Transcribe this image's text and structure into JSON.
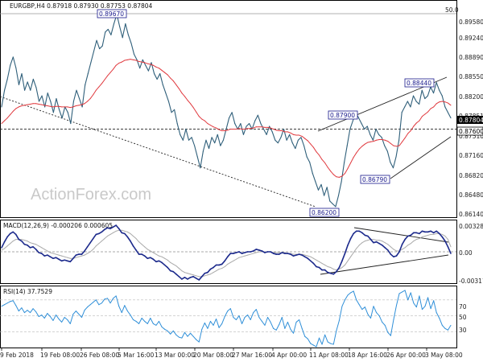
{
  "chart_data": [
    {
      "type": "line",
      "title": "EURGBP,H4  0.87918 0.87930 0.87753 0.87804",
      "watermark": "ActionForex.com",
      "y_ticks": [
        "0.89580",
        "0.89240",
        "0.88890",
        "0.88550",
        "0.88200",
        "0.87851",
        "0.87510",
        "0.87160",
        "0.86820",
        "0.86480",
        "0.86140"
      ],
      "ylim": [
        0.8601,
        0.899
      ],
      "x_ticks": [
        "9 Feb 2018",
        "19 Feb 08:00",
        "26 Feb 08:00",
        "5 Mar 16:00",
        "13 Mar 00:00",
        "20 Mar 08:00",
        "27 Mar 16:00",
        "4 Apr 00:00",
        "11 Apr 08:00",
        "18 Apr 16:00",
        "26 Apr 00:00",
        "3 May 08:00"
      ],
      "fib_label": "50.0",
      "current_price_label": "0.87804",
      "support_label": "0.87600",
      "support_level": 0.876,
      "annotations": [
        "0.89670",
        "0.87900",
        "0.88440",
        "0.86790",
        "0.86200"
      ],
      "price": [
        0.88,
        0.883,
        0.885,
        0.8875,
        0.889,
        0.887,
        0.884,
        0.886,
        0.883,
        0.8845,
        0.883,
        0.885,
        0.8835,
        0.881,
        0.882,
        0.88,
        0.8825,
        0.881,
        0.879,
        0.8815,
        0.8795,
        0.878,
        0.88,
        0.879,
        0.877,
        0.881,
        0.883,
        0.8815,
        0.88,
        0.884,
        0.886,
        0.888,
        0.89,
        0.892,
        0.8905,
        0.891,
        0.8935,
        0.894,
        0.893,
        0.895,
        0.8967,
        0.8945,
        0.8925,
        0.895,
        0.893,
        0.8915,
        0.8895,
        0.8885,
        0.887,
        0.8885,
        0.8875,
        0.8865,
        0.888,
        0.886,
        0.885,
        0.886,
        0.884,
        0.8825,
        0.881,
        0.879,
        0.8795,
        0.877,
        0.875,
        0.874,
        0.876,
        0.874,
        0.8745,
        0.873,
        0.871,
        0.869,
        0.872,
        0.874,
        0.8725,
        0.8745,
        0.8735,
        0.875,
        0.873,
        0.874,
        0.876,
        0.878,
        0.879,
        0.877,
        0.876,
        0.877,
        0.875,
        0.8765,
        0.877,
        0.876,
        0.8775,
        0.8785,
        0.877,
        0.876,
        0.875,
        0.8765,
        0.8755,
        0.874,
        0.8735,
        0.8745,
        0.876,
        0.874,
        0.875,
        0.8735,
        0.8725,
        0.874,
        0.8745,
        0.873,
        0.871,
        0.87,
        0.868,
        0.8665,
        0.865,
        0.866,
        0.864,
        0.8655,
        0.863,
        0.8625,
        0.862,
        0.864,
        0.8665,
        0.87,
        0.873,
        0.876,
        0.8775,
        0.879,
        0.878,
        0.877,
        0.876,
        0.8765,
        0.875,
        0.874,
        0.876,
        0.875,
        0.8745,
        0.873,
        0.872,
        0.87,
        0.869,
        0.871,
        0.874,
        0.879,
        0.88,
        0.881,
        0.88,
        0.882,
        0.881,
        0.8805,
        0.883,
        0.8815,
        0.882,
        0.8836,
        0.8825,
        0.8844,
        0.883,
        0.882,
        0.88,
        0.879,
        0.878
      ],
      "ma": [
        0.877,
        0.8775,
        0.878,
        0.8786,
        0.8792,
        0.8797,
        0.88,
        0.8802,
        0.8803,
        0.8804,
        0.8805,
        0.8806,
        0.8806,
        0.8805,
        0.8804,
        0.8803,
        0.8802,
        0.8801,
        0.88,
        0.8801,
        0.8801,
        0.88,
        0.88,
        0.88,
        0.8799,
        0.88,
        0.8802,
        0.8803,
        0.8804,
        0.8806,
        0.881,
        0.8815,
        0.8822,
        0.883,
        0.8836,
        0.8842,
        0.8849,
        0.8856,
        0.8862,
        0.8868,
        0.8875,
        0.8879,
        0.8881,
        0.8884,
        0.8885,
        0.8886,
        0.8885,
        0.8884,
        0.8882,
        0.8881,
        0.888,
        0.8878,
        0.8877,
        0.8875,
        0.8872,
        0.887,
        0.8866,
        0.8862,
        0.8858,
        0.8852,
        0.8847,
        0.884,
        0.8833,
        0.8825,
        0.8819,
        0.8812,
        0.8806,
        0.8799,
        0.8791,
        0.8783,
        0.8778,
        0.8775,
        0.877,
        0.8767,
        0.8764,
        0.8762,
        0.8759,
        0.8757,
        0.8757,
        0.8758,
        0.876,
        0.876,
        0.876,
        0.8761,
        0.876,
        0.876,
        0.8761,
        0.8761,
        0.8762,
        0.8764,
        0.8764,
        0.8764,
        0.8763,
        0.8763,
        0.8762,
        0.876,
        0.8758,
        0.8757,
        0.8757,
        0.8755,
        0.8755,
        0.8753,
        0.875,
        0.8749,
        0.8749,
        0.8747,
        0.8743,
        0.8739,
        0.8733,
        0.8727,
        0.8719,
        0.8713,
        0.8705,
        0.8699,
        0.8691,
        0.8684,
        0.8678,
        0.8674,
        0.8673,
        0.8675,
        0.868,
        0.8689,
        0.8699,
        0.8709,
        0.8717,
        0.8724,
        0.8729,
        0.8733,
        0.8736,
        0.8737,
        0.8738,
        0.874,
        0.8741,
        0.8741,
        0.874,
        0.8738,
        0.8734,
        0.873,
        0.8729,
        0.873,
        0.8737,
        0.8744,
        0.8752,
        0.8757,
        0.8765,
        0.8771,
        0.8775,
        0.8783,
        0.8787,
        0.8791,
        0.8797,
        0.88,
        0.8806,
        0.8809,
        0.881,
        0.8809,
        0.8807,
        0.8803
      ]
    },
    {
      "type": "line",
      "title": "MACD(12,26,9) -0.000206 0.000605",
      "y_ticks": [
        "0.003285",
        "0.00",
        "-0.003177"
      ],
      "ylim": [
        -0.0036,
        0.0036
      ],
      "series": [
        {
          "values": [
            0.0005,
            0.0012,
            0.0018,
            0.0022,
            0.0024,
            0.0021,
            0.0015,
            0.0013,
            0.0009,
            0.0008,
            0.0005,
            0.0006,
            0.0003,
            -0.0001,
            -0.0002,
            -0.0005,
            -0.0004,
            -0.0006,
            -0.0008,
            -0.0007,
            -0.0009,
            -0.0011,
            -0.001,
            -0.0011,
            -0.0012,
            -0.0008,
            -0.0004,
            -0.0003,
            -0.0003,
            0.0001,
            0.0006,
            0.0011,
            0.0016,
            0.0021,
            0.0022,
            0.0024,
            0.0027,
            0.0029,
            0.0028,
            0.003,
            0.0032,
            0.0028,
            0.0023,
            0.0022,
            0.0018,
            0.0013,
            0.0007,
            0.0002,
            -0.0003,
            -0.0003,
            -0.0005,
            -0.0008,
            -0.0007,
            -0.0009,
            -0.0012,
            -0.0011,
            -0.0013,
            -0.0016,
            -0.0019,
            -0.0023,
            -0.0024,
            -0.0027,
            -0.003,
            -0.0033,
            -0.0031,
            -0.0033,
            -0.0031,
            -0.003,
            -0.0032,
            -0.0034,
            -0.003,
            -0.0026,
            -0.0025,
            -0.0021,
            -0.0019,
            -0.0016,
            -0.0016,
            -0.0015,
            -0.0011,
            -0.0006,
            -0.0002,
            -0.0002,
            -0.0001,
            0.0,
            -0.0002,
            -0.0001,
            0.0,
            0.0,
            0.0001,
            0.0003,
            0.0002,
            0.0001,
            -0.0001,
            0.0,
            0.0,
            -0.0002,
            -0.0003,
            -0.0003,
            -0.0001,
            -0.0002,
            -0.0002,
            -0.0003,
            -0.0005,
            -0.0004,
            -0.0003,
            -0.0004,
            -0.0006,
            -0.0008,
            -0.0011,
            -0.0014,
            -0.0018,
            -0.0019,
            -0.0022,
            -0.0022,
            -0.0025,
            -0.0026,
            -0.0027,
            -0.0024,
            -0.0019,
            -0.0011,
            -0.0002,
            0.0008,
            0.0016,
            0.0022,
            0.0025,
            0.0025,
            0.0023,
            0.002,
            0.0019,
            0.0015,
            0.0011,
            0.0012,
            0.001,
            0.0008,
            0.0005,
            0.0002,
            -0.0003,
            -0.0006,
            -0.0005,
            0.0,
            0.0009,
            0.0015,
            0.0019,
            0.002,
            0.0023,
            0.0023,
            0.0022,
            0.0025,
            0.0024,
            0.0024,
            0.0025,
            0.0023,
            0.0025,
            0.0022,
            0.0018,
            0.0013,
            0.0006,
            -0.0002
          ]
        },
        {
          "values": [
            0.0002,
            0.0004,
            0.0007,
            0.001,
            0.0013,
            0.0015,
            0.0015,
            0.0015,
            0.0014,
            0.0013,
            0.0011,
            0.001,
            0.0009,
            0.0007,
            0.0005,
            0.0003,
            0.0001,
            -0.0001,
            -0.0002,
            -0.0003,
            -0.0004,
            -0.0005,
            -0.0006,
            -0.0007,
            -0.0008,
            -0.0008,
            -0.0007,
            -0.0006,
            -0.0005,
            -0.0004,
            -0.0002,
            0.0,
            0.0003,
            0.0007,
            0.001,
            0.0013,
            0.0016,
            0.0019,
            0.0021,
            0.0023,
            0.0025,
            0.0026,
            0.0026,
            0.0025,
            0.0024,
            0.0022,
            0.0019,
            0.0016,
            0.0012,
            0.0009,
            0.0006,
            0.0003,
            0.0001,
            -0.0001,
            -0.0003,
            -0.0005,
            -0.0006,
            -0.0008,
            -0.001,
            -0.0013,
            -0.0015,
            -0.0017,
            -0.002,
            -0.0023,
            -0.0025,
            -0.0026,
            -0.0027,
            -0.0028,
            -0.0029,
            -0.003,
            -0.003,
            -0.0029,
            -0.0028,
            -0.0027,
            -0.0025,
            -0.0023,
            -0.0021,
            -0.002,
            -0.0018,
            -0.0015,
            -0.0013,
            -0.0011,
            -0.0009,
            -0.0007,
            -0.0006,
            -0.0005,
            -0.0004,
            -0.0003,
            -0.0002,
            -0.0001,
            0.0,
            0.0,
            0.0,
            0.0,
            0.0,
            -0.0001,
            -0.0001,
            -0.0001,
            -0.0001,
            -0.0001,
            -0.0002,
            -0.0002,
            -0.0003,
            -0.0003,
            -0.0003,
            -0.0003,
            -0.0004,
            -0.0005,
            -0.0006,
            -0.0008,
            -0.001,
            -0.0012,
            -0.0014,
            -0.0016,
            -0.0018,
            -0.0019,
            -0.0021,
            -0.0022,
            -0.0021,
            -0.0019,
            -0.0016,
            -0.0011,
            -0.0006,
            -0.0001,
            0.0004,
            0.0008,
            0.0011,
            0.0013,
            0.0014,
            0.0015,
            0.0015,
            0.0014,
            0.0014,
            0.0013,
            0.0011,
            0.0009,
            0.0006,
            0.0003,
            0.0001,
            0.0001,
            0.0003,
            0.0005,
            0.0008,
            0.001,
            0.0013,
            0.0015,
            0.0016,
            0.0018,
            0.0019,
            0.002,
            0.0021,
            0.0021,
            0.0022,
            0.0022,
            0.0021,
            0.0019,
            0.0015,
            0.0006
          ]
        }
      ]
    },
    {
      "type": "line",
      "title": "RSI(14) 37.7529",
      "y_ticks": [
        "70",
        "50",
        "30"
      ],
      "ylim": [
        10,
        85
      ],
      "values": [
        62,
        64,
        66,
        68,
        69,
        63,
        56,
        60,
        54,
        57,
        54,
        59,
        55,
        49,
        51,
        47,
        53,
        49,
        44,
        51,
        46,
        42,
        48,
        45,
        40,
        52,
        56,
        52,
        48,
        57,
        61,
        64,
        67,
        70,
        64,
        66,
        71,
        72,
        66,
        72,
        75,
        62,
        54,
        63,
        56,
        51,
        45,
        43,
        40,
        47,
        43,
        40,
        47,
        40,
        38,
        43,
        36,
        33,
        31,
        27,
        31,
        26,
        23,
        22,
        29,
        24,
        28,
        24,
        20,
        17,
        33,
        41,
        34,
        43,
        38,
        46,
        35,
        40,
        49,
        56,
        59,
        48,
        45,
        50,
        40,
        48,
        51,
        45,
        54,
        58,
        48,
        43,
        38,
        48,
        42,
        34,
        32,
        39,
        48,
        34,
        42,
        33,
        28,
        42,
        45,
        34,
        24,
        21,
        15,
        13,
        11,
        22,
        14,
        26,
        17,
        15,
        14,
        31,
        44,
        62,
        70,
        76,
        79,
        81,
        70,
        64,
        58,
        61,
        52,
        47,
        62,
        54,
        50,
        42,
        38,
        29,
        25,
        45,
        63,
        78,
        80,
        82,
        70,
        79,
        66,
        61,
        75,
        58,
        62,
        73,
        59,
        69,
        54,
        47,
        38,
        34,
        32,
        38
      ]
    }
  ]
}
